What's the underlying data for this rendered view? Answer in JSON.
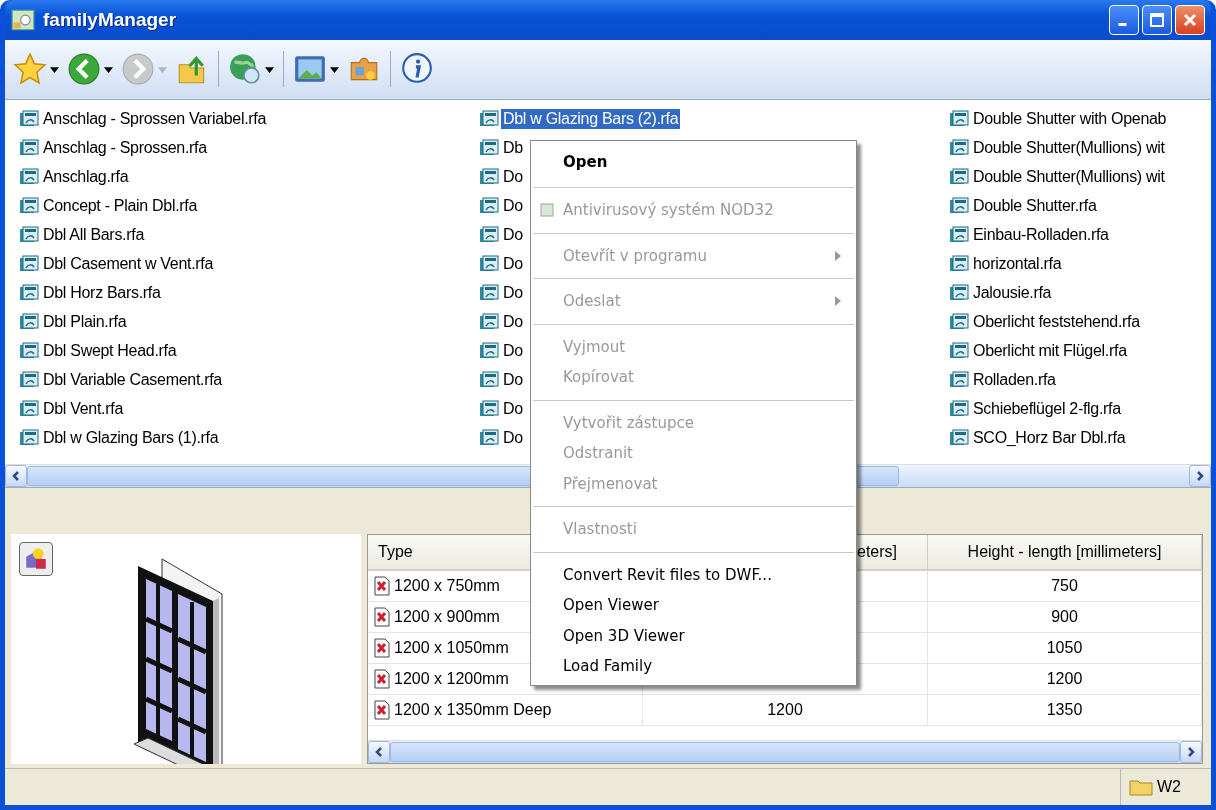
{
  "window": {
    "title": "familyManager"
  },
  "toolbar": [
    {
      "kind": "favorites",
      "dropdown": true,
      "disabled": false
    },
    {
      "kind": "back",
      "dropdown": true,
      "disabled": false
    },
    {
      "kind": "forward",
      "dropdown": true,
      "disabled": true
    },
    {
      "kind": "up",
      "dropdown": false,
      "disabled": false
    },
    {
      "kind": "globe",
      "dropdown": true,
      "disabled": false
    },
    {
      "kind": "view",
      "dropdown": true,
      "disabled": false
    },
    {
      "kind": "tools",
      "dropdown": false,
      "disabled": false
    },
    {
      "kind": "info",
      "dropdown": false,
      "disabled": false
    }
  ],
  "file_list": {
    "columns": [
      [
        {
          "name": "Anschlag - Sprossen Variabel.rfa",
          "selected": false
        },
        {
          "name": "Anschlag - Sprossen.rfa",
          "selected": false
        },
        {
          "name": "Anschlag.rfa",
          "selected": false
        },
        {
          "name": "Concept - Plain Dbl.rfa",
          "selected": false
        },
        {
          "name": "Dbl All Bars.rfa",
          "selected": false
        },
        {
          "name": "Dbl Casement w Vent.rfa",
          "selected": false
        },
        {
          "name": "Dbl Horz Bars.rfa",
          "selected": false
        },
        {
          "name": "Dbl Plain.rfa",
          "selected": false
        },
        {
          "name": "Dbl Swept Head.rfa",
          "selected": false
        },
        {
          "name": "Dbl Variable Casement.rfa",
          "selected": false
        },
        {
          "name": "Dbl Vent.rfa",
          "selected": false
        },
        {
          "name": "Dbl w Glazing Bars (1).rfa",
          "selected": false
        }
      ],
      [
        {
          "name": "Dbl w Glazing Bars (2).rfa",
          "selected": true
        },
        {
          "name": "Db",
          "selected": false
        },
        {
          "name": "Do",
          "selected": false
        },
        {
          "name": "Do",
          "selected": false
        },
        {
          "name": "Do",
          "selected": false
        },
        {
          "name": "Do",
          "selected": false
        },
        {
          "name": "Do",
          "selected": false
        },
        {
          "name": "Do",
          "selected": false
        },
        {
          "name": "Do",
          "selected": false
        },
        {
          "name": "Do",
          "selected": false
        },
        {
          "name": "Do",
          "selected": false
        },
        {
          "name": "Do",
          "selected": false
        }
      ],
      [
        {
          "name": "Double Shutter with Openab",
          "selected": false
        },
        {
          "name": "Double Shutter(Mullions) wit",
          "selected": false
        },
        {
          "name": "Double Shutter(Mullions) wit",
          "selected": false
        },
        {
          "name": "Double Shutter.rfa",
          "selected": false
        },
        {
          "name": "Einbau-Rolladen.rfa",
          "selected": false
        },
        {
          "name": "horizontal.rfa",
          "selected": false
        },
        {
          "name": "Jalousie.rfa",
          "selected": false
        },
        {
          "name": "Oberlicht feststehend.rfa",
          "selected": false
        },
        {
          "name": "Oberlicht mit Flügel.rfa",
          "selected": false
        },
        {
          "name": "Rolladen.rfa",
          "selected": false
        },
        {
          "name": "Schiebeflügel 2-flg.rfa",
          "selected": false
        },
        {
          "name": "SCO_Horz Bar Dbl.rfa",
          "selected": false
        }
      ]
    ]
  },
  "types_table": {
    "columns": [
      "Type",
      "eters]",
      "Height - length [millimeters]"
    ],
    "rows": [
      [
        "1200 x 750mm",
        "",
        "750"
      ],
      [
        "1200 x 900mm",
        "",
        "900"
      ],
      [
        "1200 x 1050mm",
        "",
        "1050"
      ],
      [
        "1200 x 1200mm",
        "",
        "1200"
      ],
      [
        "1200 x 1350mm Deep",
        "1200",
        "1350"
      ]
    ]
  },
  "context_menu": [
    {
      "kind": "item",
      "label": "Open",
      "bold": true,
      "disabled": false,
      "submenu": false,
      "icon": false
    },
    {
      "kind": "separator"
    },
    {
      "kind": "item",
      "label": "Antivirusový systém NOD32",
      "bold": false,
      "disabled": true,
      "submenu": false,
      "icon": true
    },
    {
      "kind": "separator"
    },
    {
      "kind": "item",
      "label": "Otevřít v programu",
      "bold": false,
      "disabled": true,
      "submenu": true,
      "icon": false
    },
    {
      "kind": "separator"
    },
    {
      "kind": "item",
      "label": "Odeslat",
      "bold": false,
      "disabled": true,
      "submenu": true,
      "icon": false
    },
    {
      "kind": "separator"
    },
    {
      "kind": "item",
      "label": "Vyjmout",
      "bold": false,
      "disabled": true,
      "submenu": false,
      "icon": false
    },
    {
      "kind": "item",
      "label": "Kopírovat",
      "bold": false,
      "disabled": true,
      "submenu": false,
      "icon": false
    },
    {
      "kind": "separator"
    },
    {
      "kind": "item",
      "label": "Vytvořit zástupce",
      "bold": false,
      "disabled": true,
      "submenu": false,
      "icon": false
    },
    {
      "kind": "item",
      "label": "Odstranit",
      "bold": false,
      "disabled": true,
      "submenu": false,
      "icon": false
    },
    {
      "kind": "item",
      "label": "Přejmenovat",
      "bold": false,
      "disabled": true,
      "submenu": false,
      "icon": false
    },
    {
      "kind": "separator"
    },
    {
      "kind": "item",
      "label": "Vlastnosti",
      "bold": false,
      "disabled": true,
      "submenu": false,
      "icon": false
    },
    {
      "kind": "separator"
    },
    {
      "kind": "item",
      "label": "Convert Revit files to DWF...",
      "bold": false,
      "disabled": false,
      "submenu": false,
      "icon": false
    },
    {
      "kind": "item",
      "label": "Open Viewer",
      "bold": false,
      "disabled": false,
      "submenu": false,
      "icon": false
    },
    {
      "kind": "item",
      "label": "Open 3D Viewer",
      "bold": false,
      "disabled": false,
      "submenu": false,
      "icon": false
    },
    {
      "kind": "item",
      "label": "Load Family",
      "bold": false,
      "disabled": false,
      "submenu": false,
      "icon": false
    }
  ],
  "status_bar": {
    "folder": "W2"
  }
}
